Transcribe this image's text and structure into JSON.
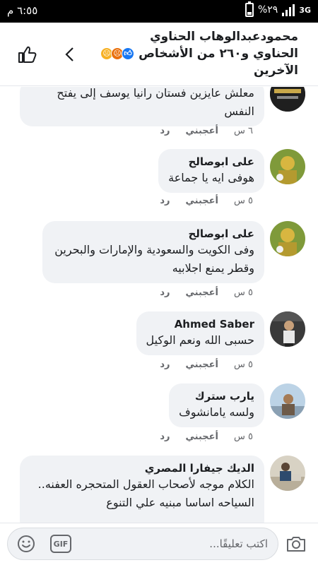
{
  "status_bar": {
    "time": "٦:٥٥ م",
    "battery": "%٢٩",
    "network": "3G"
  },
  "header": {
    "title_line1": "محمودعبدالوهاب الحناوي",
    "title_line2": "الحناوي و٢٦٠ من الأشخاص",
    "title_line3": "الآخرين",
    "reactions": [
      "like",
      "angry",
      "sad"
    ]
  },
  "comments": [
    {
      "author": "",
      "text": "معلش عايزين فستان رانيا يوسف إلى يفتح النفس",
      "time": "٦ س",
      "like_label": "أعجبني",
      "reply_label": "رد"
    },
    {
      "author": "على ابوصالح",
      "text": "هوفى ايه يا جماعة",
      "time": "٥ س",
      "like_label": "أعجبني",
      "reply_label": "رد"
    },
    {
      "author": "على ابوصالح",
      "text": "وفى الكويت والسعودية والإمارات والبحرين وقطر يمنع اجلابيه",
      "time": "٥ س",
      "like_label": "أعجبني",
      "reply_label": "رد"
    },
    {
      "author": "Ahmed Saber",
      "text": "حسبى الله ونعم الوكيل",
      "time": "٥ س",
      "like_label": "أعجبني",
      "reply_label": "رد"
    },
    {
      "author": "يارب سترك",
      "text": "ولسه يامانشوف",
      "time": "٥ س",
      "like_label": "أعجبني",
      "reply_label": "رد"
    },
    {
      "author": "الديك جيفارا المصري",
      "text": "الكلام موجه لأصحاب العقول المتحجره العفنه.. السياحه اساسا مبنيه علي التنوع",
      "time": "",
      "like_label": "",
      "reply_label": ""
    }
  ],
  "composer": {
    "placeholder": "اكتب تعليقًا...",
    "gif_label": "GIF"
  },
  "colors": {
    "bubble_bg": "#f0f2f5",
    "meta_text": "#65676b",
    "like_blue": "#1877f2",
    "angry_orange": "#e9710f",
    "sad_yellow": "#f7b125"
  },
  "icons": [
    "back-chevron-icon",
    "thumbs-up-icon",
    "camera-icon",
    "emoji-icon",
    "gif-icon"
  ]
}
